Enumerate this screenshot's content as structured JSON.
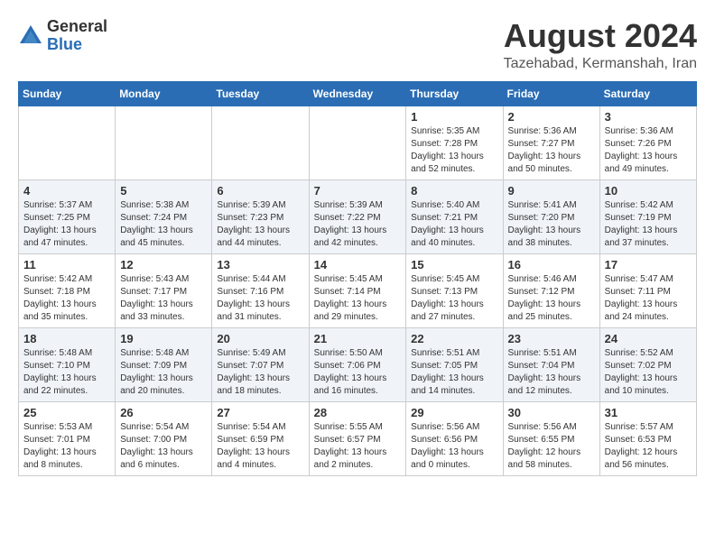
{
  "header": {
    "logo_line1": "General",
    "logo_line2": "Blue",
    "main_title": "August 2024",
    "subtitle": "Tazehabad, Kermanshah, Iran"
  },
  "calendar": {
    "days_of_week": [
      "Sunday",
      "Monday",
      "Tuesday",
      "Wednesday",
      "Thursday",
      "Friday",
      "Saturday"
    ],
    "weeks": [
      [
        {
          "day": "",
          "info": ""
        },
        {
          "day": "",
          "info": ""
        },
        {
          "day": "",
          "info": ""
        },
        {
          "day": "",
          "info": ""
        },
        {
          "day": "1",
          "info": "Sunrise: 5:35 AM\nSunset: 7:28 PM\nDaylight: 13 hours\nand 52 minutes."
        },
        {
          "day": "2",
          "info": "Sunrise: 5:36 AM\nSunset: 7:27 PM\nDaylight: 13 hours\nand 50 minutes."
        },
        {
          "day": "3",
          "info": "Sunrise: 5:36 AM\nSunset: 7:26 PM\nDaylight: 13 hours\nand 49 minutes."
        }
      ],
      [
        {
          "day": "4",
          "info": "Sunrise: 5:37 AM\nSunset: 7:25 PM\nDaylight: 13 hours\nand 47 minutes."
        },
        {
          "day": "5",
          "info": "Sunrise: 5:38 AM\nSunset: 7:24 PM\nDaylight: 13 hours\nand 45 minutes."
        },
        {
          "day": "6",
          "info": "Sunrise: 5:39 AM\nSunset: 7:23 PM\nDaylight: 13 hours\nand 44 minutes."
        },
        {
          "day": "7",
          "info": "Sunrise: 5:39 AM\nSunset: 7:22 PM\nDaylight: 13 hours\nand 42 minutes."
        },
        {
          "day": "8",
          "info": "Sunrise: 5:40 AM\nSunset: 7:21 PM\nDaylight: 13 hours\nand 40 minutes."
        },
        {
          "day": "9",
          "info": "Sunrise: 5:41 AM\nSunset: 7:20 PM\nDaylight: 13 hours\nand 38 minutes."
        },
        {
          "day": "10",
          "info": "Sunrise: 5:42 AM\nSunset: 7:19 PM\nDaylight: 13 hours\nand 37 minutes."
        }
      ],
      [
        {
          "day": "11",
          "info": "Sunrise: 5:42 AM\nSunset: 7:18 PM\nDaylight: 13 hours\nand 35 minutes."
        },
        {
          "day": "12",
          "info": "Sunrise: 5:43 AM\nSunset: 7:17 PM\nDaylight: 13 hours\nand 33 minutes."
        },
        {
          "day": "13",
          "info": "Sunrise: 5:44 AM\nSunset: 7:16 PM\nDaylight: 13 hours\nand 31 minutes."
        },
        {
          "day": "14",
          "info": "Sunrise: 5:45 AM\nSunset: 7:14 PM\nDaylight: 13 hours\nand 29 minutes."
        },
        {
          "day": "15",
          "info": "Sunrise: 5:45 AM\nSunset: 7:13 PM\nDaylight: 13 hours\nand 27 minutes."
        },
        {
          "day": "16",
          "info": "Sunrise: 5:46 AM\nSunset: 7:12 PM\nDaylight: 13 hours\nand 25 minutes."
        },
        {
          "day": "17",
          "info": "Sunrise: 5:47 AM\nSunset: 7:11 PM\nDaylight: 13 hours\nand 24 minutes."
        }
      ],
      [
        {
          "day": "18",
          "info": "Sunrise: 5:48 AM\nSunset: 7:10 PM\nDaylight: 13 hours\nand 22 minutes."
        },
        {
          "day": "19",
          "info": "Sunrise: 5:48 AM\nSunset: 7:09 PM\nDaylight: 13 hours\nand 20 minutes."
        },
        {
          "day": "20",
          "info": "Sunrise: 5:49 AM\nSunset: 7:07 PM\nDaylight: 13 hours\nand 18 minutes."
        },
        {
          "day": "21",
          "info": "Sunrise: 5:50 AM\nSunset: 7:06 PM\nDaylight: 13 hours\nand 16 minutes."
        },
        {
          "day": "22",
          "info": "Sunrise: 5:51 AM\nSunset: 7:05 PM\nDaylight: 13 hours\nand 14 minutes."
        },
        {
          "day": "23",
          "info": "Sunrise: 5:51 AM\nSunset: 7:04 PM\nDaylight: 13 hours\nand 12 minutes."
        },
        {
          "day": "24",
          "info": "Sunrise: 5:52 AM\nSunset: 7:02 PM\nDaylight: 13 hours\nand 10 minutes."
        }
      ],
      [
        {
          "day": "25",
          "info": "Sunrise: 5:53 AM\nSunset: 7:01 PM\nDaylight: 13 hours\nand 8 minutes."
        },
        {
          "day": "26",
          "info": "Sunrise: 5:54 AM\nSunset: 7:00 PM\nDaylight: 13 hours\nand 6 minutes."
        },
        {
          "day": "27",
          "info": "Sunrise: 5:54 AM\nSunset: 6:59 PM\nDaylight: 13 hours\nand 4 minutes."
        },
        {
          "day": "28",
          "info": "Sunrise: 5:55 AM\nSunset: 6:57 PM\nDaylight: 13 hours\nand 2 minutes."
        },
        {
          "day": "29",
          "info": "Sunrise: 5:56 AM\nSunset: 6:56 PM\nDaylight: 13 hours\nand 0 minutes."
        },
        {
          "day": "30",
          "info": "Sunrise: 5:56 AM\nSunset: 6:55 PM\nDaylight: 12 hours\nand 58 minutes."
        },
        {
          "day": "31",
          "info": "Sunrise: 5:57 AM\nSunset: 6:53 PM\nDaylight: 12 hours\nand 56 minutes."
        }
      ]
    ]
  }
}
